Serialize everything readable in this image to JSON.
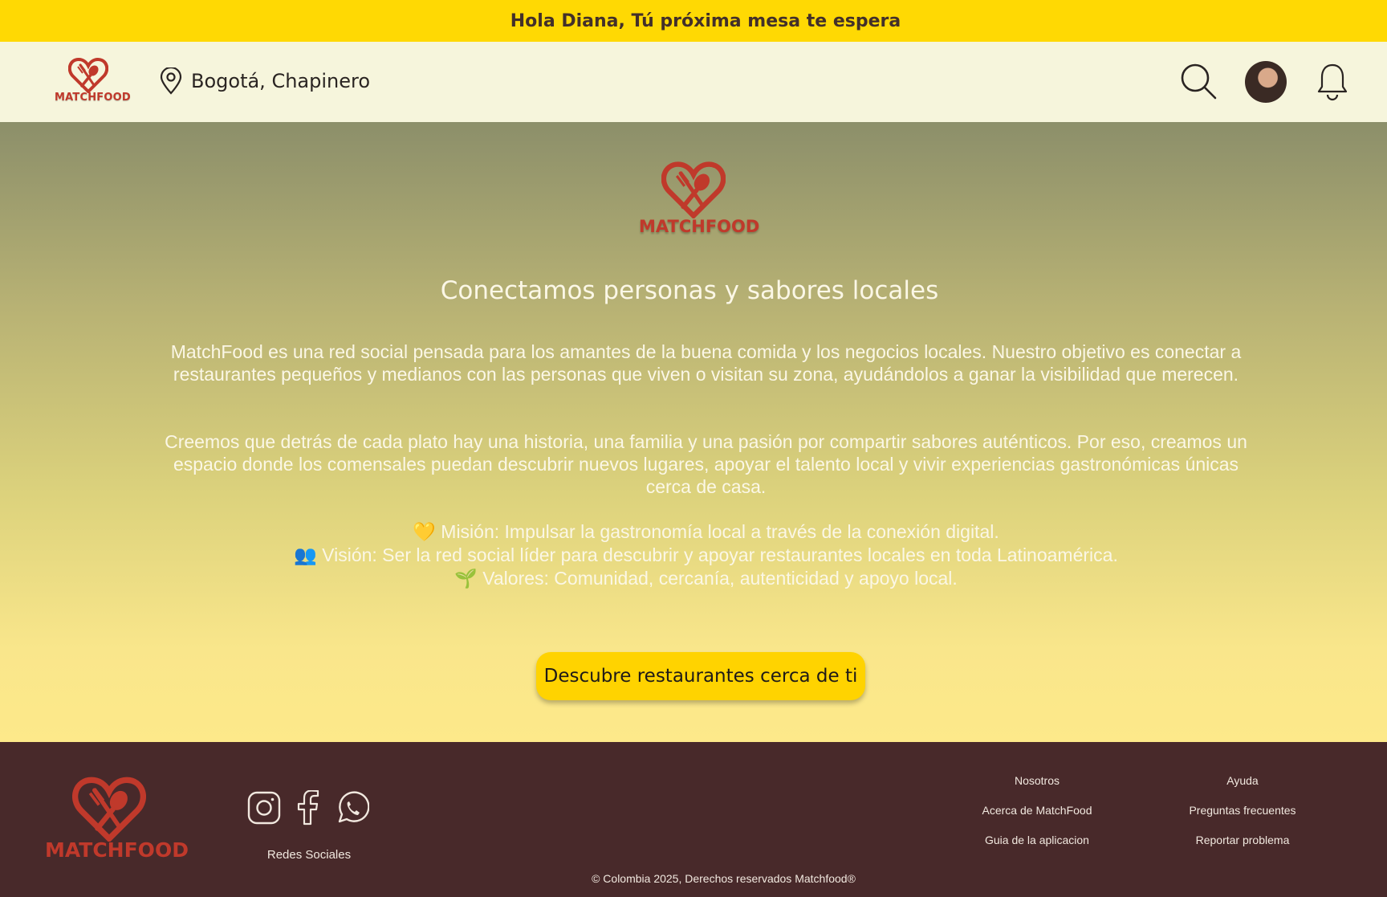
{
  "greeting_bar": {
    "text": "Hola Diana, Tú próxima mesa te espera"
  },
  "header": {
    "brand": "MATCHFOOD",
    "location": "Bogotá, Chapinero",
    "icons": [
      "pin-icon",
      "search-icon",
      "avatar",
      "bell-icon"
    ]
  },
  "hero": {
    "brand": "MATCHFOOD",
    "title": "Conectamos personas y sabores locales",
    "paragraph1": "MatchFood es una red social pensada para los amantes de la buena comida y los negocios locales. Nuestro objetivo es conectar a restaurantes pequeños y medianos con las personas que viven o visitan su zona, ayudándolos a ganar la visibilidad que merecen.",
    "paragraph2": "Creemos que detrás de cada plato hay una historia, una familia y una pasión por compartir sabores auténticos. Por eso, creamos un espacio donde los comensales puedan descubrir nuevos lugares, apoyar el talento local y vivir experiencias gastronómicas únicas cerca de casa.",
    "mission": {
      "emoji": "💛",
      "text": "Misión: Impulsar la gastronomía local a través de la conexión digital."
    },
    "vision": {
      "emoji": "👥",
      "text": "Visión: Ser la red social líder para descubrir y apoyar restaurantes locales en toda Latinoamérica."
    },
    "values": {
      "emoji": "🌱",
      "text": "Valores: Comunidad, cercanía, autenticidad y apoyo local."
    },
    "cta_label": "Descubre restaurantes cerca de ti"
  },
  "footer": {
    "brand": "MATCHFOOD",
    "social_label": "Redes Sociales",
    "social_icons": [
      "instagram-icon",
      "facebook-icon",
      "whatsapp-icon"
    ],
    "col1": [
      "Nosotros",
      "Acerca de MatchFood",
      "Guia de la aplicacion"
    ],
    "col2": [
      "Ayuda",
      "Preguntas frecuentes",
      "Reportar problema"
    ],
    "copyright": "© Colombia 2025, Derechos reservados Matchfood®"
  },
  "colors": {
    "accent_yellow": "#ffd903",
    "brand_red": "#c0392b",
    "footer_bg": "#48292a"
  }
}
